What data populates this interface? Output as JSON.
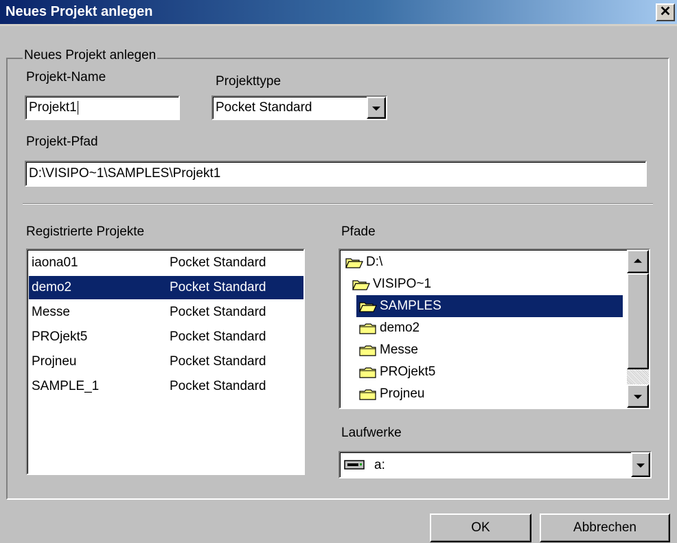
{
  "window": {
    "title": "Neues Projekt anlegen",
    "close_glyph": "✕"
  },
  "group": {
    "legend": "Neues Projekt anlegen"
  },
  "project_name": {
    "label": "Projekt-Name",
    "value": "Projekt1"
  },
  "project_type": {
    "label": "Projekttype",
    "value": "Pocket Standard"
  },
  "project_path": {
    "label": "Projekt-Pfad",
    "value": "D:\\VISIPO~1\\SAMPLES\\Projekt1"
  },
  "registered_projects": {
    "label": "Registrierte Projekte",
    "rows": [
      {
        "name": "iaona01",
        "type": "Pocket Standard",
        "selected": false
      },
      {
        "name": "demo2",
        "type": "Pocket Standard",
        "selected": true
      },
      {
        "name": "Messe",
        "type": "Pocket Standard",
        "selected": false
      },
      {
        "name": "PROjekt5",
        "type": "Pocket Standard",
        "selected": false
      },
      {
        "name": "Projneu",
        "type": "Pocket Standard",
        "selected": false
      },
      {
        "name": "SAMPLE_1",
        "type": "Pocket Standard",
        "selected": false
      }
    ]
  },
  "paths": {
    "label": "Pfade",
    "items": [
      {
        "label": "D:\\",
        "icon": "open-folder-icon",
        "selected": false
      },
      {
        "label": "VISIPO~1",
        "icon": "open-folder-icon",
        "selected": false
      },
      {
        "label": "SAMPLES",
        "icon": "open-folder-icon",
        "selected": true
      },
      {
        "label": "demo2",
        "icon": "folder-icon",
        "selected": false
      },
      {
        "label": "Messe",
        "icon": "folder-icon",
        "selected": false
      },
      {
        "label": "PROjekt5",
        "icon": "folder-icon",
        "selected": false
      },
      {
        "label": "Projneu",
        "icon": "folder-icon",
        "selected": false
      }
    ]
  },
  "drives": {
    "label": "Laufwerke",
    "value": "a:",
    "icon": "drive-icon"
  },
  "buttons": {
    "ok": "OK",
    "cancel": "Abbrechen"
  },
  "colors": {
    "selection": "#0a246a",
    "face": "#c0c0c0",
    "folder": "#ffff80"
  }
}
